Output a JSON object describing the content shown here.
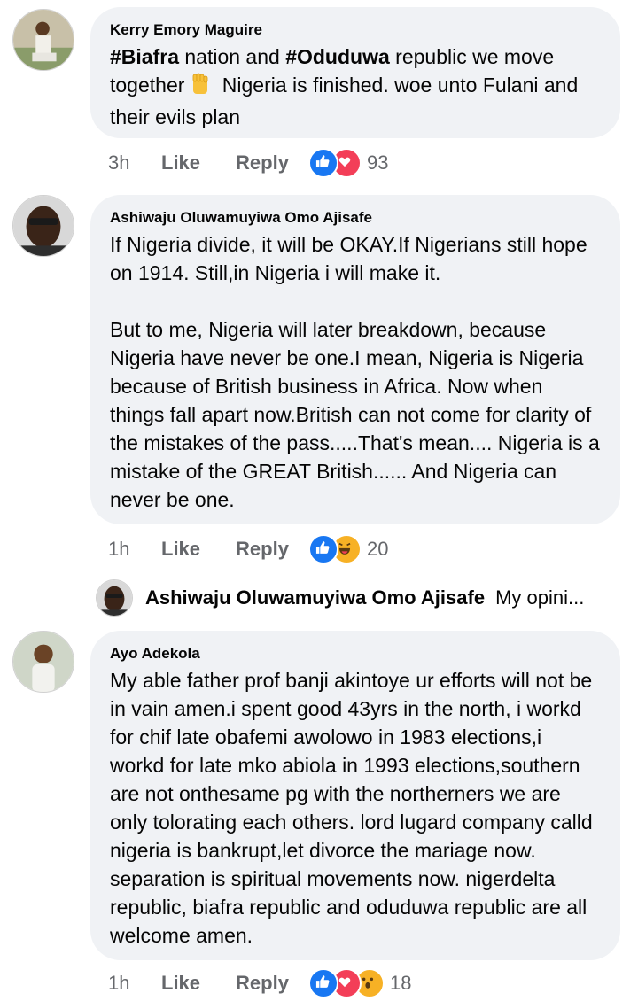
{
  "comments": [
    {
      "author": "Kerry Emory Maguire",
      "tag1": "#Biafra",
      "text_a": " nation and ",
      "tag2": "#Oduduwa",
      "text_b": " republic we move together",
      "text_c": " Nigeria is finished. woe unto Fulani and their evils plan",
      "time": "3h",
      "like": "Like",
      "reply": "Reply",
      "reaction_icons": [
        "like-icon",
        "love-icon"
      ],
      "reaction_count": "93"
    },
    {
      "author": "Ashiwaju Oluwamuyiwa Omo Ajisafe",
      "text": "If Nigeria divide, it will be OKAY.If Nigerians still hope on 1914. Still,in Nigeria i will make it.\n\nBut to me, Nigeria will later breakdown, because Nigeria have never be one.I mean, Nigeria is Nigeria because of British business in Africa. Now when things fall apart now.British can not come for clarity of the mistakes of the pass.....That's mean.... Nigeria is a mistake of the GREAT British...... And Nigeria can never be one.",
      "time": "1h",
      "like": "Like",
      "reply": "Reply",
      "reaction_icons": [
        "like-icon",
        "haha-icon"
      ],
      "reaction_count": "20"
    },
    {
      "author": "Ayo Adekola",
      "text": "My able father prof banji akintoye ur efforts will not be in vain amen.i spent good 43yrs in the north, i workd for chif late obafemi awolowo in 1983 elections,i workd for late mko abiola in 1993 elections,southern are not onthesame pg with the northerners we are only tolorating each others. lord lugard company calld nigeria is bankrupt,let divorce the mariage now. separation is spiritual movements now. nigerdelta republic, biafra republic and oduduwa republic are all welcome amen.",
      "time": "1h",
      "like": "Like",
      "reply": "Reply",
      "reaction_icons": [
        "like-icon",
        "love-icon",
        "wow-icon"
      ],
      "reaction_count": "18"
    }
  ],
  "reply_preview": {
    "author": "Ashiwaju Oluwamuyiwa Omo Ajisafe",
    "snippet": "My opini..."
  },
  "colors": {
    "bubble": "#f0f2f5",
    "like": "#1877f2",
    "love": "#f33e58",
    "haha": "#f7b125",
    "meta": "#65676b"
  }
}
